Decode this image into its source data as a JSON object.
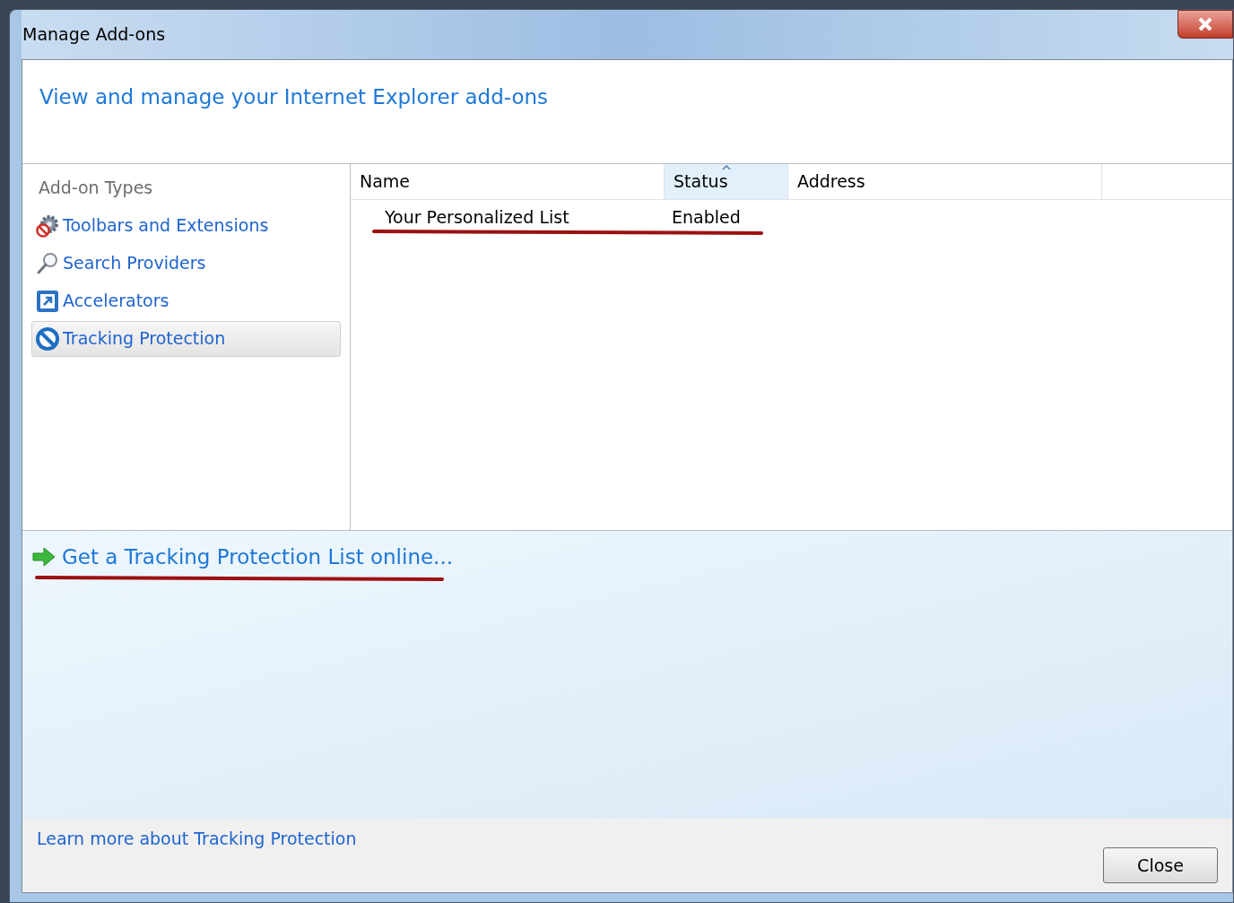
{
  "window": {
    "title": "Manage Add-ons"
  },
  "header": {
    "title": "View and manage your Internet Explorer add-ons"
  },
  "sidebar": {
    "heading": "Add-on Types",
    "items": [
      {
        "label": "Toolbars and Extensions",
        "kind": "gear",
        "selected": false
      },
      {
        "label": "Search Providers",
        "kind": "magnifier",
        "selected": false
      },
      {
        "label": "Accelerators",
        "kind": "accelerator",
        "selected": false
      },
      {
        "label": "Tracking Protection",
        "kind": "blocked",
        "selected": true
      }
    ]
  },
  "table": {
    "columns": [
      {
        "label": "Name",
        "selected": false
      },
      {
        "label": "Status",
        "selected": true
      },
      {
        "label": "Address",
        "selected": false
      }
    ],
    "rows": [
      {
        "cells": [
          "Your Personalized List",
          "Enabled"
        ],
        "underlined": true
      }
    ]
  },
  "details": {
    "link": "Get a Tracking Protection List online...",
    "underlined": true
  },
  "footer": {
    "link": "Learn more about Tracking Protection",
    "button": "Close"
  }
}
